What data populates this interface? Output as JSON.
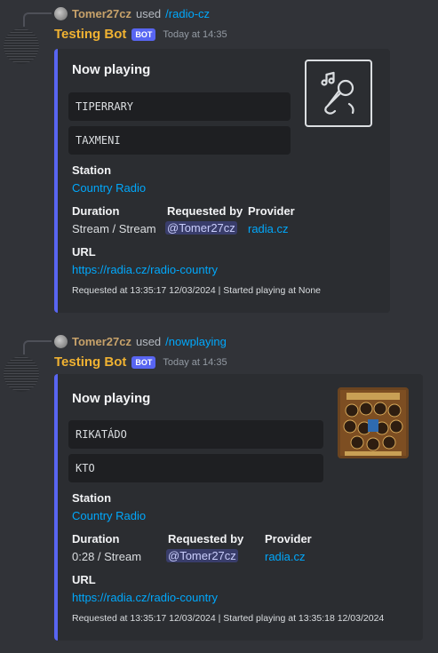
{
  "messages": [
    {
      "reply": {
        "username": "Tomer27cz",
        "used_text": "used",
        "command": "/radio-cz"
      },
      "author": {
        "name": "Testing Bot",
        "badge": "BOT",
        "timestamp": "Today at 14:35"
      },
      "embed": {
        "title": "Now playing",
        "lines": [
          "TIPERRARY",
          "TAXMENI"
        ],
        "station_label": "Station",
        "station_value": "Country Radio",
        "duration_label": "Duration",
        "duration_value": "Stream / Stream",
        "requested_label": "Requested by",
        "requested_value": "@Tomer27cz",
        "provider_label": "Provider",
        "provider_value": "radia.cz",
        "url_label": "URL",
        "url_value": "https://radia.cz/radio-country",
        "footer": "Requested at 13:35:17 12/03/2024 | Started playing at None",
        "thumbnail_icon": "music-microphone-icon"
      }
    },
    {
      "reply": {
        "username": "Tomer27cz",
        "used_text": "used",
        "command": "/nowplaying"
      },
      "author": {
        "name": "Testing Bot",
        "badge": "BOT",
        "timestamp": "Today at 14:35"
      },
      "embed": {
        "title": "Now playing",
        "lines": [
          "RIKATÁDO",
          "KTO"
        ],
        "station_label": "Station",
        "station_value": "Country Radio",
        "duration_label": "Duration",
        "duration_value": "0:28 / Stream",
        "requested_label": "Requested by",
        "requested_value": "@Tomer27cz",
        "provider_label": "Provider",
        "provider_value": "radia.cz",
        "url_label": "URL",
        "url_value": "https://radia.cz/radio-country",
        "footer": "Requested at 13:35:17 12/03/2024 | Started playing at 13:35:18 12/03/2024",
        "thumbnail_icon": "album-art-image"
      }
    }
  ],
  "colors": {
    "background": "#313338",
    "embed_bg": "#2b2d31",
    "accent": "#5865f2",
    "bot_name": "#f0b232",
    "link": "#00a8fc"
  }
}
